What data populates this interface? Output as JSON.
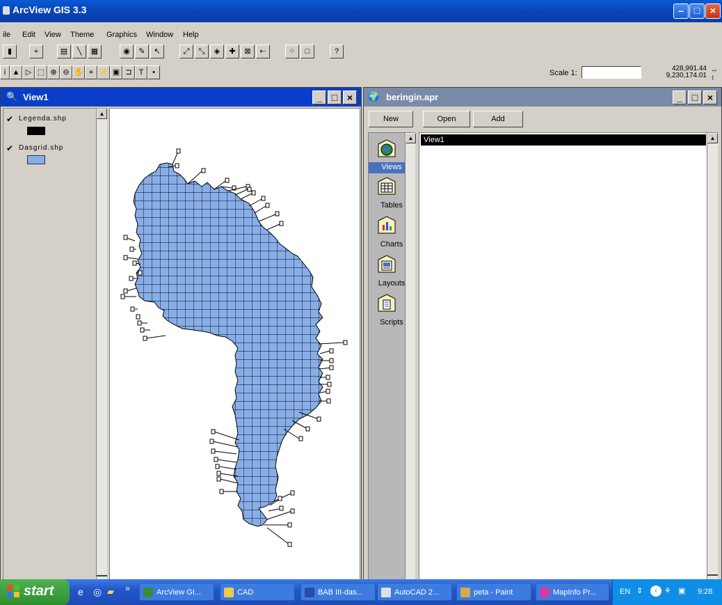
{
  "window": {
    "title": "ArcView GIS 3.3"
  },
  "menu": [
    "ile",
    "Edit",
    "View",
    "Theme",
    "Graphics",
    "Window",
    "Help"
  ],
  "toolbar2": {
    "scale_label": "Scale 1:",
    "scale_value": "",
    "coord_x": "428,991.44",
    "coord_y": "9,230,174.01"
  },
  "view_window": {
    "title": "View1",
    "themes": [
      {
        "name": "Legenda.shp",
        "checked": true,
        "symbol_color": "#000000"
      },
      {
        "name": "Dasgrid.shp",
        "checked": true,
        "symbol_color": "#88aee8"
      }
    ]
  },
  "project_window": {
    "title": "beringin.apr",
    "buttons": {
      "new": "New",
      "open": "Open",
      "add": "Add"
    },
    "doc_types": [
      "Views",
      "Tables",
      "Charts",
      "Layouts",
      "Scripts"
    ],
    "selected_doc_type": "Views",
    "documents": [
      "View1"
    ]
  },
  "taskbar": {
    "start": "start",
    "items": [
      "ArcView GI...",
      "CAD",
      "BAB III-das...",
      "AutoCAD 2...",
      "peta - Paint",
      "MapInfo Pr..."
    ],
    "language": "EN",
    "clock": "9:28"
  },
  "colors": {
    "map_fill": "#88aee8",
    "title_active": "#0a3ec8",
    "selected_doc": "#000000"
  }
}
